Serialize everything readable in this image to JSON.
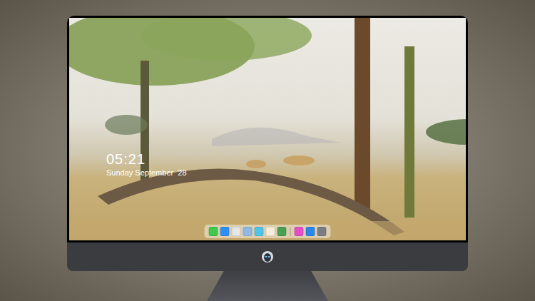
{
  "clock": {
    "time": "05:21",
    "date": "Sunday September  28"
  },
  "dock": {
    "items": [
      {
        "kind": "app",
        "color": "#3ec94a"
      },
      {
        "kind": "app",
        "color": "#2f8ef5"
      },
      {
        "kind": "app",
        "color": "#e6e6e6"
      },
      {
        "kind": "app",
        "color": "#8fb8e6"
      },
      {
        "kind": "app",
        "color": "#4fc3ea"
      },
      {
        "kind": "app",
        "color": "#f4eed8"
      },
      {
        "kind": "app",
        "color": "#4aa052"
      },
      {
        "kind": "separator",
        "color": "#9a9a9a"
      },
      {
        "kind": "app",
        "color": "#e44fc6"
      },
      {
        "kind": "app",
        "color": "#2c86ea"
      },
      {
        "kind": "app",
        "color": "#7b7d82"
      }
    ]
  }
}
